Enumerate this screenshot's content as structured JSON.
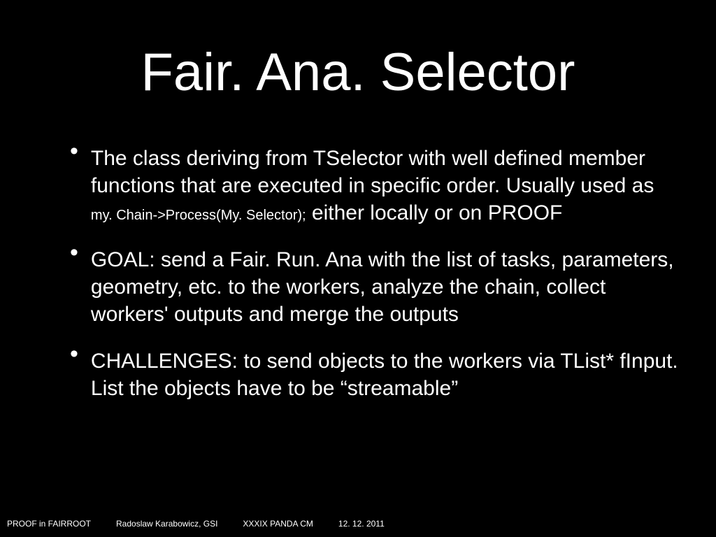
{
  "title": "Fair. Ana. Selector",
  "bullets": [
    {
      "text_before": "The class deriving from TSelector with well defined member functions that are executed in specific order. Usually used as ",
      "code": "my. Chain->Process(My. Selector);",
      "text_after": " either locally or on PROOF"
    },
    {
      "text_before": "GOAL: send a Fair. Run. Ana with the list of tasks, parameters, geometry, etc. to the workers, analyze the chain, collect workers' outputs and merge the outputs",
      "code": "",
      "text_after": ""
    },
    {
      "text_before": "CHALLENGES: to send objects to the workers via TList* fInput. List the objects have to be “streamable”",
      "code": "",
      "text_after": ""
    }
  ],
  "footer": {
    "left": "PROOF in FAIRROOT",
    "author": "Radoslaw Karabowicz, GSI",
    "event": "XXXIX PANDA CM",
    "date": "12. 12. 2011"
  }
}
